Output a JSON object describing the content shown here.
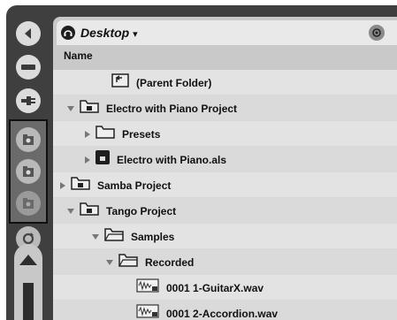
{
  "browser": {
    "location": "Desktop",
    "location_dropdown": "▾",
    "column_header": "Name"
  },
  "rows": [
    {
      "label": "(Parent Folder)",
      "icon": "parent-folder-icon",
      "expand": "none"
    },
    {
      "label": "Electro with Piano Project",
      "icon": "project-folder-icon",
      "expand": "open"
    },
    {
      "label": "Presets",
      "icon": "folder-icon",
      "expand": "closed"
    },
    {
      "label": "Electro with Piano.als",
      "icon": "live-set-file-icon",
      "expand": "closed"
    },
    {
      "label": "Samba Project",
      "icon": "project-folder-icon",
      "expand": "closed"
    },
    {
      "label": "Tango Project",
      "icon": "project-folder-icon",
      "expand": "open"
    },
    {
      "label": "Samples",
      "icon": "open-folder-icon",
      "expand": "open"
    },
    {
      "label": "Recorded",
      "icon": "open-folder-icon",
      "expand": "open"
    },
    {
      "label": "0001 1-GuitarX.wav",
      "icon": "audio-file-icon",
      "expand": "none"
    },
    {
      "label": "0001 2-Accordion.wav",
      "icon": "audio-file-icon",
      "expand": "none"
    }
  ],
  "rail": {
    "buttons": [
      "collapse-arrow-icon",
      "device-browser-icon",
      "plugin-browser-icon",
      "place-1-icon",
      "place-2-icon",
      "place-3-icon",
      "refresh-icon"
    ]
  },
  "colors": {
    "chassis": "#3f3f3f",
    "panel": "#c9c9c9",
    "row": "#e3e3e3",
    "row_alt": "#dadada"
  }
}
